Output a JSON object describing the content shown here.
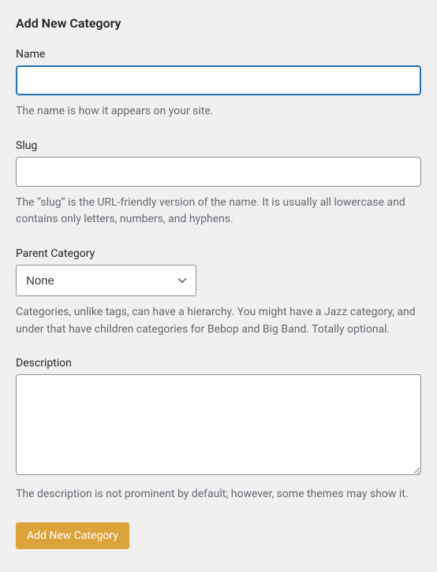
{
  "heading": "Add New Category",
  "fields": {
    "name": {
      "label": "Name",
      "value": "",
      "help": "The name is how it appears on your site."
    },
    "slug": {
      "label": "Slug",
      "value": "",
      "help": "The “slug” is the URL-friendly version of the name. It is usually all lowercase and contains only letters, numbers, and hyphens."
    },
    "parent": {
      "label": "Parent Category",
      "selected": "None",
      "help": "Categories, unlike tags, can have a hierarchy. You might have a Jazz category, and under that have children categories for Bebop and Big Band. Totally optional."
    },
    "description": {
      "label": "Description",
      "value": "",
      "help": "The description is not prominent by default; however, some themes may show it."
    }
  },
  "submit_label": "Add New Category"
}
